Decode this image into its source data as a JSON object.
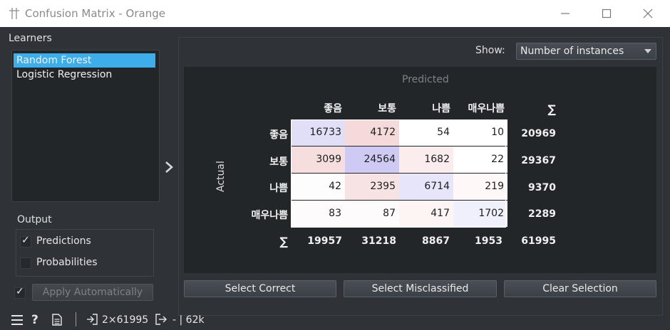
{
  "window": {
    "title": "Confusion Matrix - Orange",
    "app_icon": "confusion-matrix-icon",
    "controls": [
      "minimize-icon",
      "maximize-icon",
      "close-icon"
    ]
  },
  "learners": {
    "label": "Learners",
    "items": [
      {
        "label": "Random Forest",
        "selected": true
      },
      {
        "label": "Logistic Regression",
        "selected": false
      }
    ]
  },
  "output": {
    "label": "Output",
    "predictions": {
      "label": "Predictions",
      "checked": true
    },
    "probabilities": {
      "label": "Probabilities",
      "checked": false
    },
    "apply_automatically": {
      "label": "Apply Automatically",
      "checked": true,
      "enabled": false
    }
  },
  "show": {
    "label": "Show:",
    "value": "Number of instances"
  },
  "matrix": {
    "predicted_label": "Predicted",
    "actual_label": "Actual",
    "classes": [
      "좋음",
      "보통",
      "나쁨",
      "매우나쁨"
    ],
    "sum_symbol": "∑",
    "rows": [
      {
        "values": [
          16733,
          4172,
          54,
          10
        ],
        "sum": "20969"
      },
      {
        "values": [
          3099,
          24564,
          1682,
          22
        ],
        "sum": "29367"
      },
      {
        "values": [
          42,
          2395,
          6714,
          219
        ],
        "sum": "9370"
      },
      {
        "values": [
          83,
          87,
          417,
          1702
        ],
        "sum": "2289"
      }
    ],
    "column_sums": [
      "19957",
      "31218",
      "8867",
      "1953"
    ],
    "total": "61995",
    "cell_colors": [
      [
        "#e1def8",
        "#f5d9db",
        "#ffffff",
        "#ffffff"
      ],
      [
        "#f6dedf",
        "#cfcaf3",
        "#fbeced",
        "#ffffff"
      ],
      [
        "#fefdfd",
        "#f8e3e4",
        "#e6e5fa",
        "#fff8f8"
      ],
      [
        "#fdfbfb",
        "#fdfbfb",
        "#fcf5f4",
        "#f0effc"
      ]
    ]
  },
  "buttons": {
    "select_correct": "Select Correct",
    "select_misclassified": "Select Misclassified",
    "clear_selection": "Clear Selection"
  },
  "status": {
    "input_summary": "2×61995",
    "output_summary": "- | 62k",
    "icons": [
      "menu-icon",
      "help-icon",
      "report-icon",
      "input-icon",
      "output-icon"
    ]
  }
}
